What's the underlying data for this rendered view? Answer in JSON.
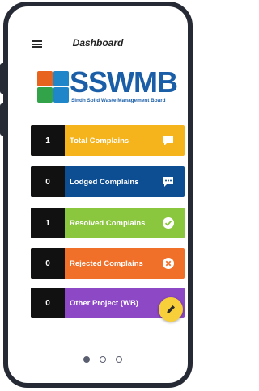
{
  "header": {
    "title": "Dashboard",
    "menu_icon": "hamburger-menu-icon"
  },
  "logo": {
    "text_parts": [
      {
        "text": "SS",
        "color": "#1a5ea8"
      },
      {
        "text": "WMB",
        "color": "#1a5ea8"
      }
    ],
    "subtitle": "Sindh Solid Waste Management Board"
  },
  "cards": [
    {
      "count": "1",
      "label": "Total Complains",
      "color": "#f5b31c",
      "icon": "chat-bubble-icon"
    },
    {
      "count": "0",
      "label": "Lodged Complains",
      "color": "#0d4d91",
      "icon": "chat-dots-icon"
    },
    {
      "count": "1",
      "label": "Resolved Complains",
      "color": "#8bc63f",
      "icon": "check-circle-icon"
    },
    {
      "count": "0",
      "label": "Rejected Complains",
      "color": "#f0702a",
      "icon": "x-circle-icon"
    },
    {
      "count": "0",
      "label": "Other Project (WB)",
      "color": "#8d48c6",
      "icon": ""
    }
  ],
  "fab": {
    "icon": "pencil-icon",
    "color": "#f7cf3a"
  },
  "pager": {
    "total": 3,
    "active": 1
  }
}
